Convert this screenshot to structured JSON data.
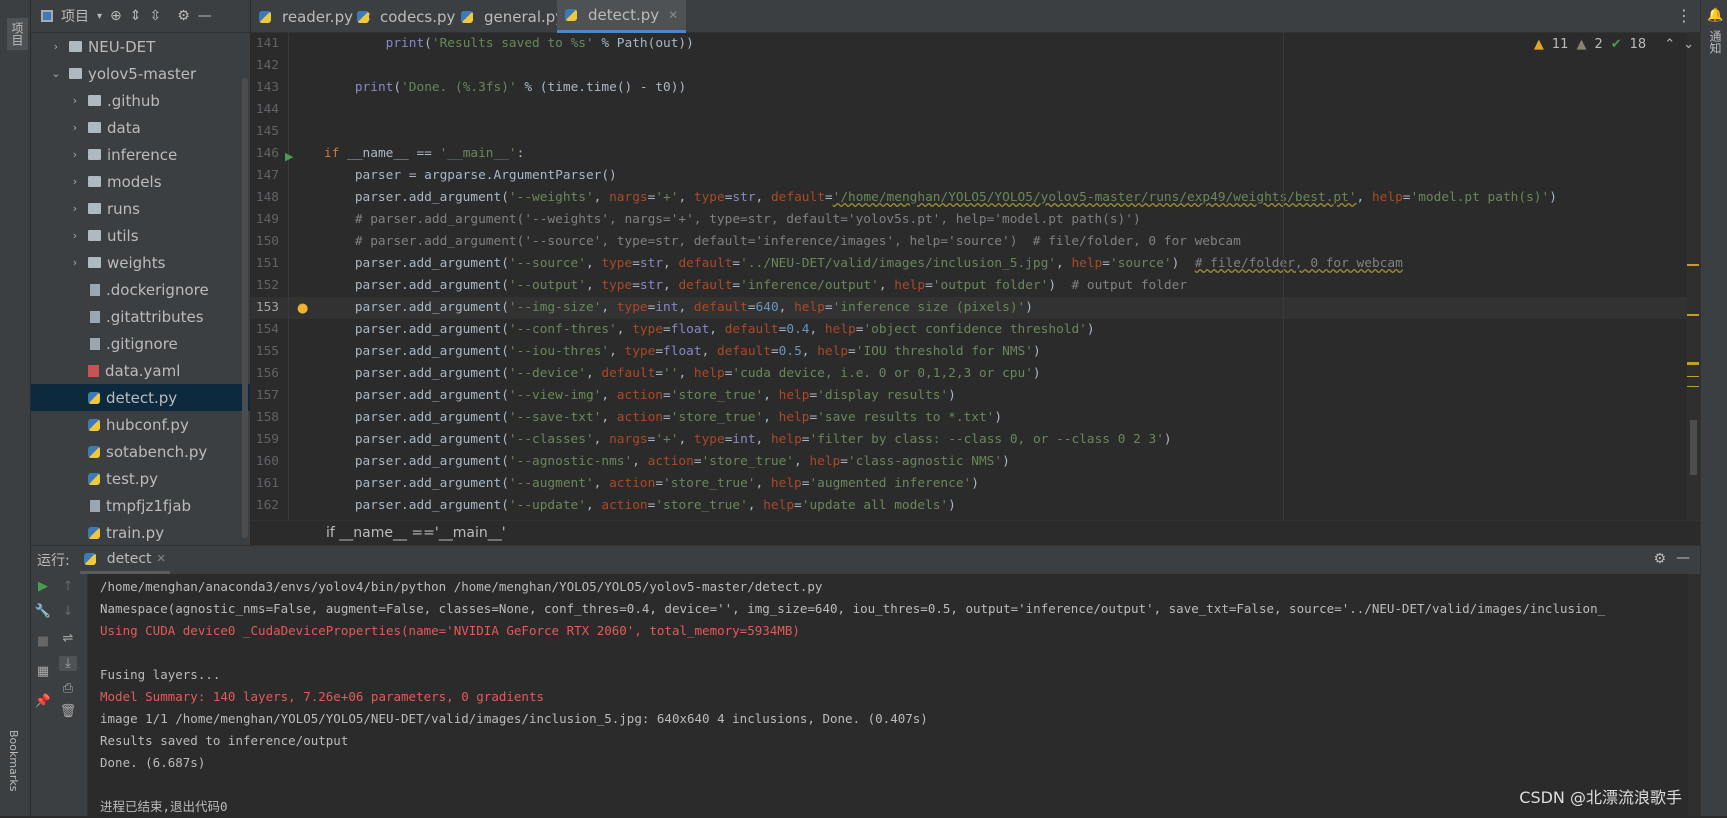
{
  "left_strip": {
    "project_label": "项目",
    "bookmarks_label": "Bookmarks"
  },
  "right_strip": {
    "notifications_label": "通知"
  },
  "sidebar": {
    "title": "项目",
    "items": [
      {
        "label": "NEU-DET",
        "type": "folder",
        "level": 1,
        "expanded": false
      },
      {
        "label": "yolov5-master",
        "type": "folder",
        "level": 1,
        "expanded": true
      },
      {
        "label": ".github",
        "type": "folder",
        "level": 2,
        "expanded": false
      },
      {
        "label": "data",
        "type": "folder",
        "level": 2,
        "expanded": false
      },
      {
        "label": "inference",
        "type": "folder",
        "level": 2,
        "expanded": false
      },
      {
        "label": "models",
        "type": "folder",
        "level": 2,
        "expanded": false
      },
      {
        "label": "runs",
        "type": "folder",
        "level": 2,
        "expanded": false
      },
      {
        "label": "utils",
        "type": "folder",
        "level": 2,
        "expanded": false
      },
      {
        "label": "weights",
        "type": "folder",
        "level": 2,
        "expanded": false
      },
      {
        "label": ".dockerignore",
        "type": "file",
        "level": 2
      },
      {
        "label": ".gitattributes",
        "type": "file",
        "level": 2
      },
      {
        "label": ".gitignore",
        "type": "file",
        "level": 2
      },
      {
        "label": "data.yaml",
        "type": "yaml",
        "level": 2
      },
      {
        "label": "detect.py",
        "type": "py",
        "level": 2,
        "selected": true
      },
      {
        "label": "hubconf.py",
        "type": "py",
        "level": 2
      },
      {
        "label": "sotabench.py",
        "type": "py",
        "level": 2
      },
      {
        "label": "test.py",
        "type": "py",
        "level": 2
      },
      {
        "label": "tmpfjz1fjab",
        "type": "file",
        "level": 2
      },
      {
        "label": "train.py",
        "type": "py",
        "level": 2
      }
    ]
  },
  "tabs": [
    {
      "label": "reader.py"
    },
    {
      "label": "codecs.py"
    },
    {
      "label": "general.py"
    },
    {
      "label": "detect.py",
      "active": true
    }
  ],
  "inspections": {
    "warnings": "11",
    "weak_warnings": "2",
    "typos": "18"
  },
  "editor": {
    "current_line": "153",
    "lines": [
      {
        "n": "141",
        "t": [
          [
            "        ",
            ""
          ],
          [
            "print",
            "bi"
          ],
          [
            "(",
            "df"
          ],
          [
            "'Results saved to %s'",
            "st"
          ],
          [
            " % Path(out))",
            "df"
          ]
        ]
      },
      {
        "n": "142",
        "t": []
      },
      {
        "n": "143",
        "t": [
          [
            "    ",
            ""
          ],
          [
            "print",
            "bi"
          ],
          [
            "(",
            "df"
          ],
          [
            "'Done. (%.3fs)'",
            "st"
          ],
          [
            " % (time.time() - t0))",
            "df"
          ]
        ]
      },
      {
        "n": "144",
        "t": []
      },
      {
        "n": "145",
        "t": []
      },
      {
        "n": "146",
        "t": [
          [
            "if ",
            "kw"
          ],
          [
            "__name__ == ",
            "df"
          ],
          [
            "'__main__'",
            "st"
          ],
          [
            ":",
            "df"
          ]
        ]
      },
      {
        "n": "147",
        "t": [
          [
            "    parser = argparse.ArgumentParser()",
            "df"
          ]
        ]
      },
      {
        "n": "148",
        "t": [
          [
            "    parser.add_argument(",
            "df"
          ],
          [
            "'--weights'",
            "st"
          ],
          [
            ", ",
            "df"
          ],
          [
            "nargs",
            "pa"
          ],
          [
            "=",
            "df"
          ],
          [
            "'+'",
            "st"
          ],
          [
            ", ",
            "df"
          ],
          [
            "type",
            "pa"
          ],
          [
            "=",
            "df"
          ],
          [
            "str",
            "bi"
          ],
          [
            ", ",
            "df"
          ],
          [
            "default",
            "pa"
          ],
          [
            "=",
            "df"
          ],
          [
            "'/home/menghan/YOLO5/YOLO5/yolov5-master/runs/exp49/weights/best.pt'",
            "st wv"
          ],
          [
            ", ",
            "df"
          ],
          [
            "help",
            "pa"
          ],
          [
            "=",
            "df"
          ],
          [
            "'model.pt path(s)'",
            "st"
          ],
          [
            ")",
            "df"
          ]
        ]
      },
      {
        "n": "149",
        "t": [
          [
            "    # parser.add_argument('--weights', nargs='+', type=str, default='yolov5s.pt', help='model.pt path(s)')",
            "cm"
          ]
        ]
      },
      {
        "n": "150",
        "t": [
          [
            "    # parser.add_argument('--source', type=str, default='inference/images', help='source')  # file/folder, 0 for webcam",
            "cm"
          ]
        ]
      },
      {
        "n": "151",
        "t": [
          [
            "    parser.add_argument(",
            "df"
          ],
          [
            "'--source'",
            "st"
          ],
          [
            ", ",
            "df"
          ],
          [
            "type",
            "pa"
          ],
          [
            "=",
            "df"
          ],
          [
            "str",
            "bi"
          ],
          [
            ", ",
            "df"
          ],
          [
            "default",
            "pa"
          ],
          [
            "=",
            "df"
          ],
          [
            "'../NEU-DET/valid/images/inclusion_5.jpg'",
            "st"
          ],
          [
            ", ",
            "df"
          ],
          [
            "help",
            "pa"
          ],
          [
            "=",
            "df"
          ],
          [
            "'source'",
            "st"
          ],
          [
            ")  ",
            "df"
          ],
          [
            "# file/folder, 0 for webcam",
            "cm wv"
          ]
        ]
      },
      {
        "n": "152",
        "t": [
          [
            "    parser.add_argument(",
            "df"
          ],
          [
            "'--output'",
            "st"
          ],
          [
            ", ",
            "df"
          ],
          [
            "type",
            "pa"
          ],
          [
            "=",
            "df"
          ],
          [
            "str",
            "bi"
          ],
          [
            ", ",
            "df"
          ],
          [
            "default",
            "pa"
          ],
          [
            "=",
            "df"
          ],
          [
            "'inference/output'",
            "st"
          ],
          [
            ", ",
            "df"
          ],
          [
            "help",
            "pa"
          ],
          [
            "=",
            "df"
          ],
          [
            "'output folder'",
            "st"
          ],
          [
            ")  ",
            "df"
          ],
          [
            "# output folder",
            "cm"
          ]
        ]
      },
      {
        "n": "153",
        "t": [
          [
            "    parser.add_argument(",
            "df"
          ],
          [
            "'--img-size'",
            "st"
          ],
          [
            ", ",
            "df"
          ],
          [
            "type",
            "pa"
          ],
          [
            "=",
            "df"
          ],
          [
            "int",
            "bi"
          ],
          [
            ", ",
            "df"
          ],
          [
            "default",
            "pa"
          ],
          [
            "=",
            "df"
          ],
          [
            "640",
            "nm"
          ],
          [
            ", ",
            "df"
          ],
          [
            "help",
            "pa"
          ],
          [
            "=",
            "df"
          ],
          [
            "'inference size (pixels)'",
            "st"
          ],
          [
            ")",
            "df"
          ]
        ]
      },
      {
        "n": "154",
        "t": [
          [
            "    parser.add_argument(",
            "df"
          ],
          [
            "'--conf-thres'",
            "st"
          ],
          [
            ", ",
            "df"
          ],
          [
            "type",
            "pa"
          ],
          [
            "=",
            "df"
          ],
          [
            "float",
            "bi"
          ],
          [
            ", ",
            "df"
          ],
          [
            "default",
            "pa"
          ],
          [
            "=",
            "df"
          ],
          [
            "0.4",
            "nm"
          ],
          [
            ", ",
            "df"
          ],
          [
            "help",
            "pa"
          ],
          [
            "=",
            "df"
          ],
          [
            "'object confidence threshold'",
            "st"
          ],
          [
            ")",
            "df"
          ]
        ]
      },
      {
        "n": "155",
        "t": [
          [
            "    parser.add_argument(",
            "df"
          ],
          [
            "'--iou-thres'",
            "st"
          ],
          [
            ", ",
            "df"
          ],
          [
            "type",
            "pa"
          ],
          [
            "=",
            "df"
          ],
          [
            "float",
            "bi"
          ],
          [
            ", ",
            "df"
          ],
          [
            "default",
            "pa"
          ],
          [
            "=",
            "df"
          ],
          [
            "0.5",
            "nm"
          ],
          [
            ", ",
            "df"
          ],
          [
            "help",
            "pa"
          ],
          [
            "=",
            "df"
          ],
          [
            "'IOU threshold for NMS'",
            "st"
          ],
          [
            ")",
            "df"
          ]
        ]
      },
      {
        "n": "156",
        "t": [
          [
            "    parser.add_argument(",
            "df"
          ],
          [
            "'--device'",
            "st"
          ],
          [
            ", ",
            "df"
          ],
          [
            "default",
            "pa"
          ],
          [
            "=",
            "df"
          ],
          [
            "''",
            "st"
          ],
          [
            ", ",
            "df"
          ],
          [
            "help",
            "pa"
          ],
          [
            "=",
            "df"
          ],
          [
            "'cuda device, i.e. 0 or 0,1,2,3 or cpu'",
            "st"
          ],
          [
            ")",
            "df"
          ]
        ]
      },
      {
        "n": "157",
        "t": [
          [
            "    parser.add_argument(",
            "df"
          ],
          [
            "'--view-img'",
            "st"
          ],
          [
            ", ",
            "df"
          ],
          [
            "action",
            "pa"
          ],
          [
            "=",
            "df"
          ],
          [
            "'store_true'",
            "st"
          ],
          [
            ", ",
            "df"
          ],
          [
            "help",
            "pa"
          ],
          [
            "=",
            "df"
          ],
          [
            "'display results'",
            "st"
          ],
          [
            ")",
            "df"
          ]
        ]
      },
      {
        "n": "158",
        "t": [
          [
            "    parser.add_argument(",
            "df"
          ],
          [
            "'--save-txt'",
            "st"
          ],
          [
            ", ",
            "df"
          ],
          [
            "action",
            "pa"
          ],
          [
            "=",
            "df"
          ],
          [
            "'store_true'",
            "st"
          ],
          [
            ", ",
            "df"
          ],
          [
            "help",
            "pa"
          ],
          [
            "=",
            "df"
          ],
          [
            "'save results to *.txt'",
            "st"
          ],
          [
            ")",
            "df"
          ]
        ]
      },
      {
        "n": "159",
        "t": [
          [
            "    parser.add_argument(",
            "df"
          ],
          [
            "'--classes'",
            "st"
          ],
          [
            ", ",
            "df"
          ],
          [
            "nargs",
            "pa"
          ],
          [
            "=",
            "df"
          ],
          [
            "'+'",
            "st"
          ],
          [
            ", ",
            "df"
          ],
          [
            "type",
            "pa"
          ],
          [
            "=",
            "df"
          ],
          [
            "int",
            "bi"
          ],
          [
            ", ",
            "df"
          ],
          [
            "help",
            "pa"
          ],
          [
            "=",
            "df"
          ],
          [
            "'filter by class: --class 0, or --class 0 2 3'",
            "st"
          ],
          [
            ")",
            "df"
          ]
        ]
      },
      {
        "n": "160",
        "t": [
          [
            "    parser.add_argument(",
            "df"
          ],
          [
            "'--agnostic-nms'",
            "st"
          ],
          [
            ", ",
            "df"
          ],
          [
            "action",
            "pa"
          ],
          [
            "=",
            "df"
          ],
          [
            "'store_true'",
            "st"
          ],
          [
            ", ",
            "df"
          ],
          [
            "help",
            "pa"
          ],
          [
            "=",
            "df"
          ],
          [
            "'class-agnostic NMS'",
            "st"
          ],
          [
            ")",
            "df"
          ]
        ]
      },
      {
        "n": "161",
        "t": [
          [
            "    parser.add_argument(",
            "df"
          ],
          [
            "'--augment'",
            "st"
          ],
          [
            ", ",
            "df"
          ],
          [
            "action",
            "pa"
          ],
          [
            "=",
            "df"
          ],
          [
            "'store_true'",
            "st"
          ],
          [
            ", ",
            "df"
          ],
          [
            "help",
            "pa"
          ],
          [
            "=",
            "df"
          ],
          [
            "'augmented inference'",
            "st"
          ],
          [
            ")",
            "df"
          ]
        ]
      },
      {
        "n": "162",
        "t": [
          [
            "    parser.add_argument(",
            "df"
          ],
          [
            "'--update'",
            "st"
          ],
          [
            ", ",
            "df"
          ],
          [
            "action",
            "pa"
          ],
          [
            "=",
            "df"
          ],
          [
            "'store_true'",
            "st"
          ],
          [
            ", ",
            "df"
          ],
          [
            "help",
            "pa"
          ],
          [
            "=",
            "df"
          ],
          [
            "'update all models'",
            "st"
          ],
          [
            ")",
            "df"
          ]
        ]
      }
    ]
  },
  "breadcrumb": "if __name__ =='__main__'",
  "run_panel": {
    "label": "运行:",
    "tab": "detect",
    "lines": [
      {
        "text": "/home/menghan/anaconda3/envs/yolov4/bin/python /home/menghan/YOLO5/YOLO5/yolov5-master/detect.py",
        "err": false
      },
      {
        "text": "Namespace(agnostic_nms=False, augment=False, classes=None, conf_thres=0.4, device='', img_size=640, iou_thres=0.5, output='inference/output', save_txt=False, source='../NEU-DET/valid/images/inclusion_",
        "err": false
      },
      {
        "text": "Using CUDA device0 _CudaDeviceProperties(name='NVIDIA GeForce RTX 2060', total_memory=5934MB)",
        "err": true
      },
      {
        "text": "",
        "err": false
      },
      {
        "text": "Fusing layers...",
        "err": false
      },
      {
        "text": "Model Summary: 140 layers, 7.26e+06 parameters, 0 gradients",
        "err": true
      },
      {
        "text": "image 1/1 /home/menghan/YOLO5/YOLO5/NEU-DET/valid/images/inclusion_5.jpg: 640x640 4 inclusions, Done. (0.407s)",
        "err": false
      },
      {
        "text": "Results saved to inference/output",
        "err": false
      },
      {
        "text": "Done. (6.687s)",
        "err": false
      },
      {
        "text": "",
        "err": false
      },
      {
        "text": "进程已结束,退出代码0",
        "err": false
      }
    ]
  },
  "watermark": "CSDN @北漂流浪歌手"
}
